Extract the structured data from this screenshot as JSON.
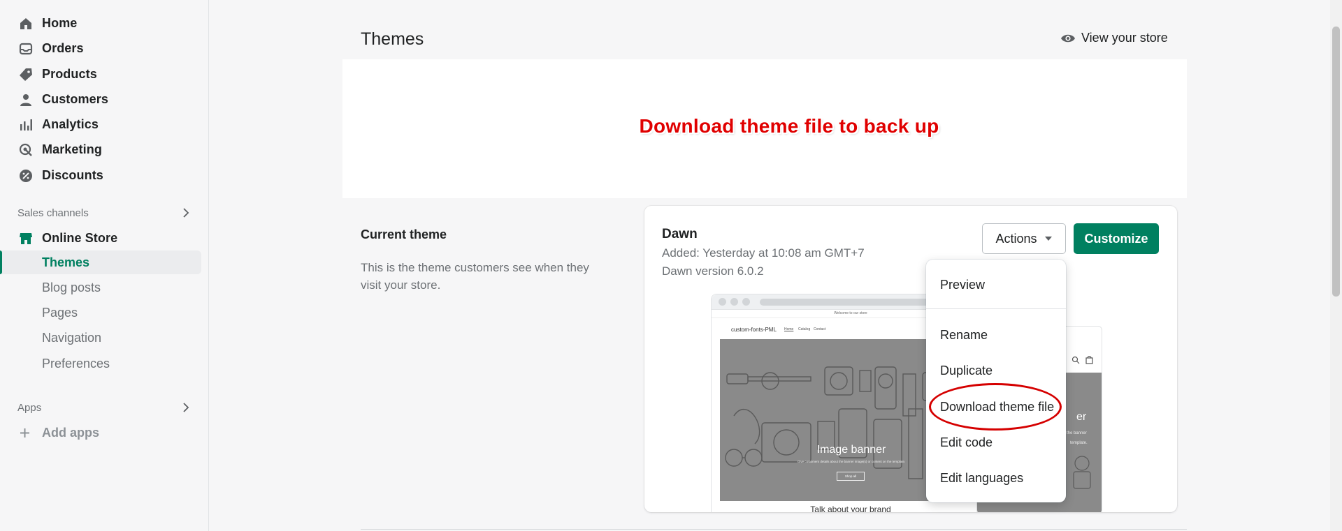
{
  "sidebar": {
    "items": [
      {
        "label": "Home",
        "icon": "home-icon"
      },
      {
        "label": "Orders",
        "icon": "orders-icon"
      },
      {
        "label": "Products",
        "icon": "tag-icon"
      },
      {
        "label": "Customers",
        "icon": "person-icon"
      },
      {
        "label": "Analytics",
        "icon": "bar-chart-icon"
      },
      {
        "label": "Marketing",
        "icon": "target-icon"
      },
      {
        "label": "Discounts",
        "icon": "discount-icon"
      }
    ],
    "sales_channels_label": "Sales channels",
    "online_store_label": "Online Store",
    "sub_items": [
      "Themes",
      "Blog posts",
      "Pages",
      "Navigation",
      "Preferences"
    ],
    "apps_label": "Apps",
    "add_apps_label": "Add apps"
  },
  "header": {
    "title": "Themes",
    "view_store_label": "View your store"
  },
  "banner": {
    "annotation": "Download theme file to back up"
  },
  "current_theme": {
    "title": "Current theme",
    "description": "This is the theme customers see when they visit your store."
  },
  "theme_card": {
    "name": "Dawn",
    "added": "Added: Yesterday at 10:08 am GMT+7",
    "version": "Dawn version 6.0.2",
    "actions_label": "Actions",
    "customize_label": "Customize",
    "preview": {
      "announcement": "Welcome to our store",
      "store_name": "custom-fonts-PML",
      "nav_links": [
        "Home",
        "Catalog",
        "Contact"
      ],
      "banner_title": "Image banner",
      "banner_sub": "Give customers details about the banner image(s) or content on the template.",
      "banner_button": "Shop all",
      "below_text": "Talk about your brand",
      "mobile_banner_title": "er",
      "mobile_banner_sub": "the banner",
      "mobile_banner_sub2": "template."
    }
  },
  "actions_menu": {
    "items": [
      "Preview",
      "Rename",
      "Duplicate",
      "Download theme file",
      "Edit code",
      "Edit languages"
    ]
  },
  "colors": {
    "accent": "#008060",
    "annotation_red": "#e00000"
  }
}
